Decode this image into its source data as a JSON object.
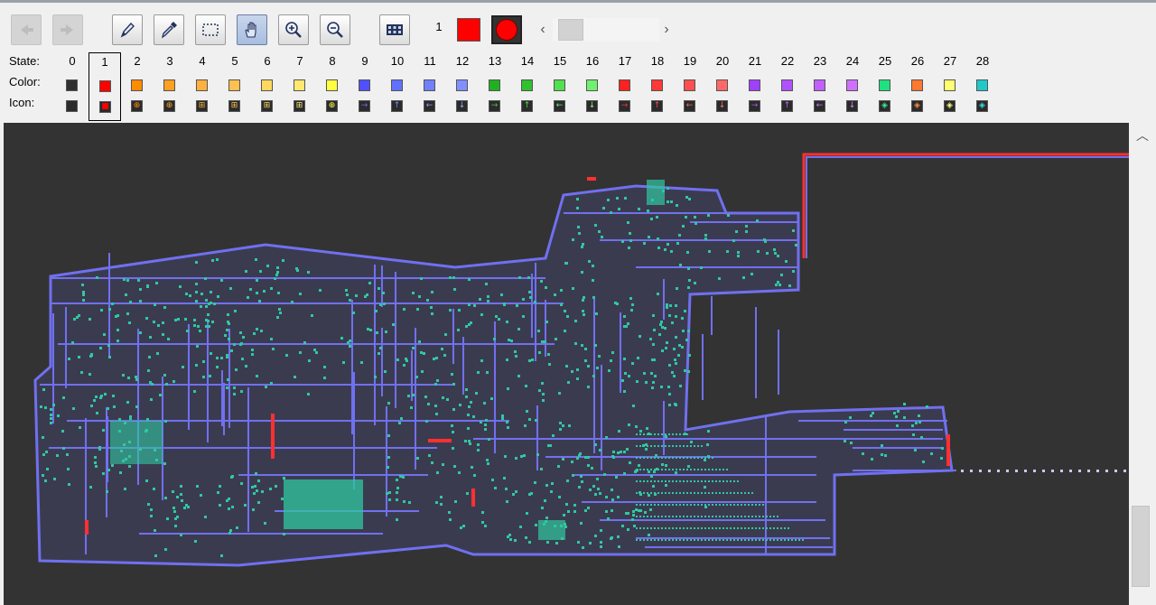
{
  "toolbar": {
    "buttons": [
      {
        "name": "undo-button",
        "icon": "undo-arrow-icon",
        "state": "disabled"
      },
      {
        "name": "redo-button",
        "icon": "redo-arrow-icon",
        "state": "disabled"
      },
      {
        "name": "draw-tool-button",
        "icon": "pencil-icon",
        "state": "normal"
      },
      {
        "name": "pick-tool-button",
        "icon": "eyedropper-icon",
        "state": "normal"
      },
      {
        "name": "select-tool-button",
        "icon": "selection-rectangle-icon",
        "state": "normal"
      },
      {
        "name": "move-tool-button",
        "icon": "hand-icon",
        "state": "active"
      },
      {
        "name": "zoom-in-button",
        "icon": "zoom-in-icon",
        "state": "normal"
      },
      {
        "name": "zoom-out-button",
        "icon": "zoom-out-icon",
        "state": "normal"
      },
      {
        "name": "state-panel-button",
        "icon": "grid-icon",
        "state": "normal"
      }
    ],
    "current_state_number": "1",
    "current_state_color": "#ff0000"
  },
  "legend": {
    "state_label": "State:",
    "color_label": "Color:",
    "icon_label": "Icon:",
    "selected_state": 1,
    "states": [
      {
        "num": "0",
        "color": "#303030",
        "icon": "",
        "icon_color": "#303030"
      },
      {
        "num": "1",
        "color": "#ff0000",
        "icon": "■",
        "icon_color": "#ff0000"
      },
      {
        "num": "2",
        "color": "#ff8c00",
        "icon": "⊕",
        "icon_color": "#ff8c00"
      },
      {
        "num": "3",
        "color": "#ffa020",
        "icon": "⊕",
        "icon_color": "#ffa020"
      },
      {
        "num": "4",
        "color": "#ffb040",
        "icon": "⊞",
        "icon_color": "#ffb040"
      },
      {
        "num": "5",
        "color": "#ffc050",
        "icon": "⊞",
        "icon_color": "#ffc050"
      },
      {
        "num": "6",
        "color": "#ffd860",
        "icon": "⊞",
        "icon_color": "#ffd860"
      },
      {
        "num": "7",
        "color": "#ffe870",
        "icon": "⊞",
        "icon_color": "#ffe870"
      },
      {
        "num": "8",
        "color": "#ffff40",
        "icon": "⊕",
        "icon_color": "#ffff40"
      },
      {
        "num": "9",
        "color": "#5050ff",
        "icon": "→",
        "icon_color": "#6a6aff"
      },
      {
        "num": "10",
        "color": "#6070ff",
        "icon": "↑",
        "icon_color": "#7a8aff"
      },
      {
        "num": "11",
        "color": "#7080ff",
        "icon": "←",
        "icon_color": "#8a9aff"
      },
      {
        "num": "12",
        "color": "#8090ff",
        "icon": "↓",
        "icon_color": "#9aaaff"
      },
      {
        "num": "13",
        "color": "#20b020",
        "icon": "→",
        "icon_color": "#30d030"
      },
      {
        "num": "14",
        "color": "#30c030",
        "icon": "↑",
        "icon_color": "#40e040"
      },
      {
        "num": "15",
        "color": "#50e050",
        "icon": "←",
        "icon_color": "#60f060"
      },
      {
        "num": "16",
        "color": "#70f070",
        "icon": "↓",
        "icon_color": "#80ff80"
      },
      {
        "num": "17",
        "color": "#ff2020",
        "icon": "→",
        "icon_color": "#ff3030"
      },
      {
        "num": "18",
        "color": "#ff3838",
        "icon": "↑",
        "icon_color": "#ff4848"
      },
      {
        "num": "19",
        "color": "#ff5050",
        "icon": "←",
        "icon_color": "#ff6060"
      },
      {
        "num": "20",
        "color": "#ff6868",
        "icon": "↓",
        "icon_color": "#ff7878"
      },
      {
        "num": "21",
        "color": "#a040ff",
        "icon": "→",
        "icon_color": "#b050ff"
      },
      {
        "num": "22",
        "color": "#b050ff",
        "icon": "↑",
        "icon_color": "#c060ff"
      },
      {
        "num": "23",
        "color": "#c060ff",
        "icon": "←",
        "icon_color": "#d070ff"
      },
      {
        "num": "24",
        "color": "#d070ff",
        "icon": "↓",
        "icon_color": "#e080ff"
      },
      {
        "num": "25",
        "color": "#20e080",
        "icon": "◈",
        "icon_color": "#30f090"
      },
      {
        "num": "26",
        "color": "#ff7830",
        "icon": "◈",
        "icon_color": "#ff8840"
      },
      {
        "num": "27",
        "color": "#ffff70",
        "icon": "◈",
        "icon_color": "#ffff80"
      },
      {
        "num": "28",
        "color": "#20c8c8",
        "icon": "◈",
        "icon_color": "#30e0e0"
      }
    ]
  },
  "canvas": {
    "background": "#333333",
    "wire_color": "#7070f0",
    "cell_color": "#30c8a0",
    "signal_color": "#ff3030"
  }
}
